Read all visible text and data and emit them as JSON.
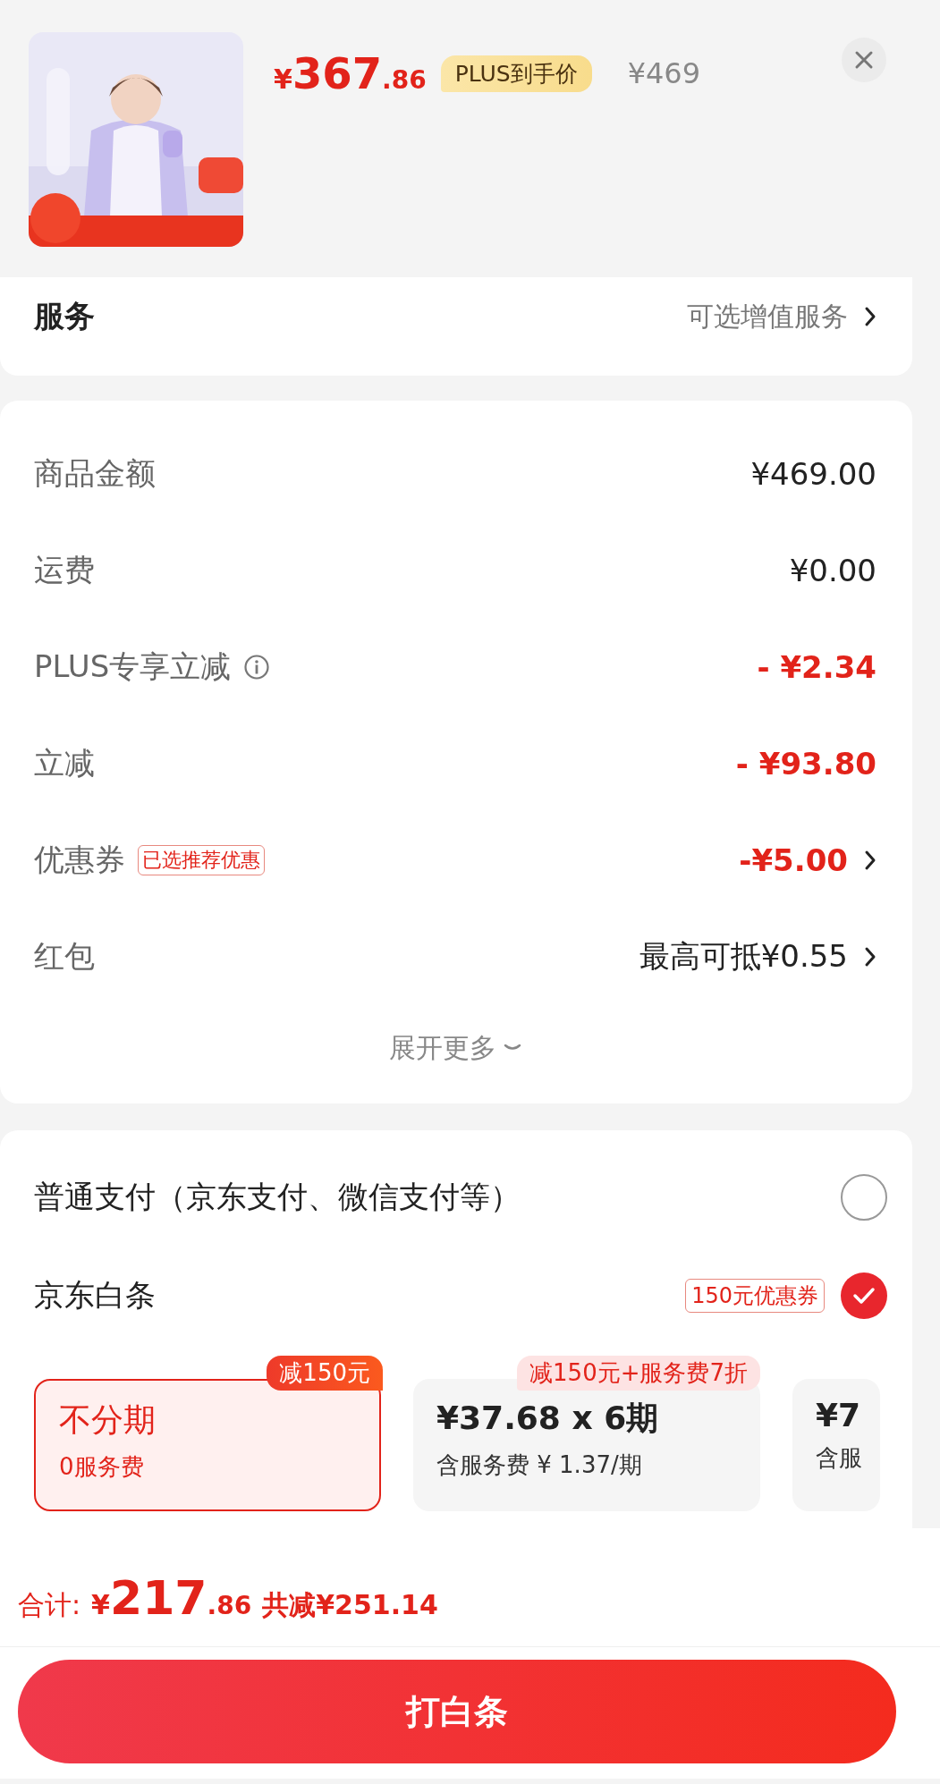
{
  "product": {
    "currency": "¥",
    "price_main": "367",
    "price_decimal": ".86",
    "price_badge": "PLUS到手价",
    "original_price": "¥469"
  },
  "services": {
    "label": "服务",
    "value": "可选增值服务"
  },
  "summary": {
    "rows": [
      {
        "label": "商品金额",
        "value": "¥469.00",
        "kind": "amount",
        "chevron": false
      },
      {
        "label": "运费",
        "value": "¥0.00",
        "kind": "amount",
        "chevron": false
      },
      {
        "label": "PLUS专享立减",
        "info": true,
        "value": "- ¥2.34",
        "kind": "discount",
        "chevron": false
      },
      {
        "label": "立减",
        "value": "- ¥93.80",
        "kind": "discount",
        "chevron": false
      },
      {
        "label": "优惠券",
        "tag": "已选推荐优惠",
        "value": "-¥5.00",
        "kind": "discount",
        "chevron": true
      },
      {
        "label": "红包",
        "value": "最高可抵¥0.55",
        "kind": "amount",
        "chevron": true
      }
    ],
    "expand": "展开更多"
  },
  "payment": {
    "methods": [
      {
        "label": "普通支付（京东支付、微信支付等）",
        "selected": false
      },
      {
        "label": "京东白条",
        "tag": "150元优惠券",
        "selected": true
      }
    ],
    "plans": [
      {
        "title": "不分期",
        "subtitle": "0服务费",
        "badge": "减150元",
        "selected": true
      },
      {
        "title": "¥37.68 x 6期",
        "subtitle": "含服务费 ¥ 1.37/期",
        "badge": "减150元+服务费7折",
        "selected": false
      },
      {
        "title": "¥7",
        "subtitle": "含服",
        "selected": false
      }
    ]
  },
  "footer": {
    "total_label": "合计:",
    "currency": "¥",
    "total_main": "217",
    "total_decimal": ".86",
    "saved": "共减¥251.14",
    "button": "打白条"
  }
}
